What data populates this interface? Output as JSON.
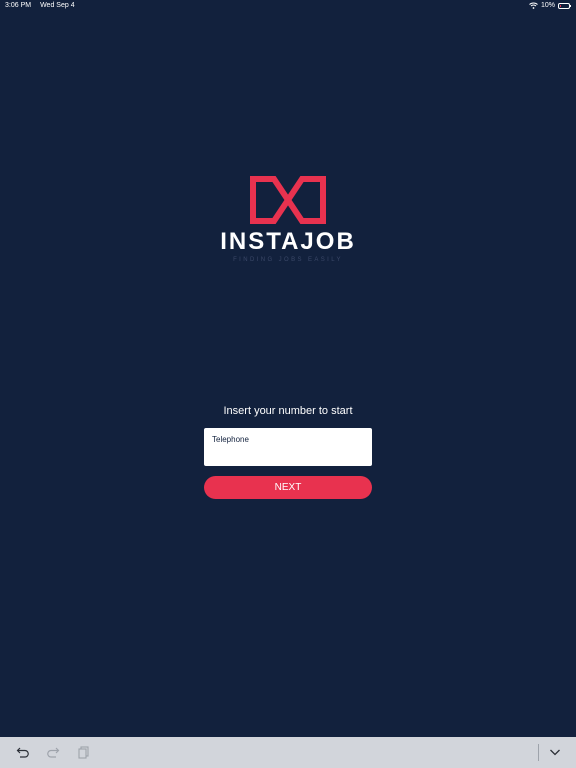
{
  "status_bar": {
    "time": "3:06 PM",
    "date": "Wed Sep 4",
    "battery": "10%"
  },
  "logo": {
    "name": "INSTAJOB",
    "tagline": "FINDING JOBS EASILY"
  },
  "form": {
    "prompt": "Insert your number to start",
    "telephone_placeholder": "Telephone",
    "next_label": "NEXT"
  },
  "toolbar": {
    "icons": [
      "undo-icon",
      "redo-icon",
      "paste-icon",
      "chevron-down-icon"
    ]
  },
  "colors": {
    "background": "#12213d",
    "accent": "#e8324f",
    "toolbar": "#d2d5db"
  }
}
